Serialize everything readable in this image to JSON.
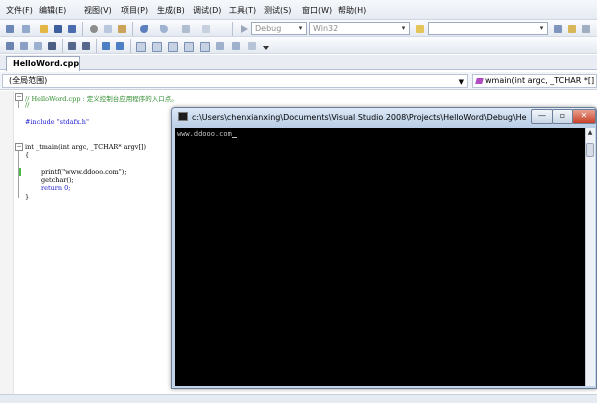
{
  "menubar": {
    "items": [
      "文件(F)",
      "编辑(E)",
      "视图(V)",
      "项目(P)",
      "生成(B)",
      "调试(D)",
      "工具(T)",
      "测试(S)",
      "窗口(W)",
      "帮助(H)"
    ]
  },
  "toolbar": {
    "config_combo": "Debug",
    "platform_combo": "Win32"
  },
  "document": {
    "tab_label": "HelloWord.cpp"
  },
  "navbar": {
    "scope": "(全局范围)",
    "member": "wmain(int argc, _TCHAR *[] argv"
  },
  "editor": {
    "lines": {
      "l1": "// HelloWord.cpp : 定义控制台应用程序的入口点。",
      "l2": "//",
      "l3": "#include \"stdafx.h\"",
      "l4": "int _tmain(int argc, _TCHAR* argv[])",
      "l5": "{",
      "l6": "printf(\"www.ddooo.com\");",
      "l7": "getchar();",
      "l8": "return 0;",
      "l9": "}"
    }
  },
  "console": {
    "title": "c:\\Users\\chenxianxing\\Documents\\Visual Studio 2008\\Projects\\HelloWord\\Debug\\HelloW...",
    "output": "www.ddooo.com",
    "background": "#000000",
    "text_color": "#c0c0c0"
  },
  "icons": {
    "toolbar": [
      "new-project-icon",
      "add-item-icon",
      "open-file-icon",
      "save-icon",
      "save-all-icon",
      "cut-icon",
      "copy-icon",
      "paste-icon",
      "undo-icon",
      "redo-icon",
      "start-debug-icon",
      "find-icon"
    ]
  },
  "colors": {
    "comment": "#2e8b2e",
    "keyword": "#1a1ad0",
    "string": "#a31515"
  }
}
